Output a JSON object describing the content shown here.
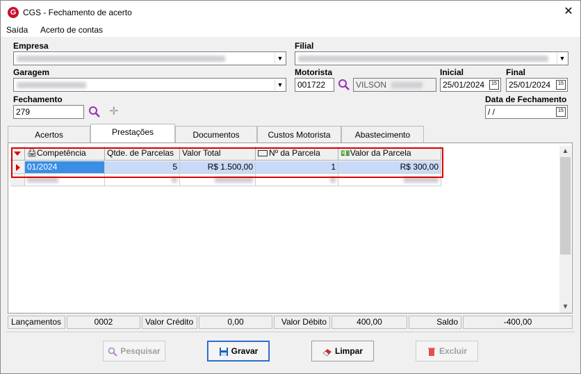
{
  "window": {
    "title": "CGS - Fechamento de acerto",
    "close_glyph": "✕",
    "app_icon_letter": "G"
  },
  "menu": [
    {
      "label": "Saída"
    },
    {
      "label": "Acerto de contas"
    }
  ],
  "form": {
    "empresa_label": "Empresa",
    "filial_label": "Filial",
    "garagem_label": "Garagem",
    "motorista_label": "Motorista",
    "motorista_code": "001722",
    "motorista_name": "VILSON",
    "inicial_label": "Inicial",
    "inicial_value": "25/01/2024",
    "final_label": "Final",
    "final_value": "25/01/2024",
    "fechamento_label": "Fechamento",
    "fechamento_value": "279",
    "data_fechamento_label": "Data de Fechamento",
    "data_fechamento_value": " / /",
    "calendar_glyph": "15"
  },
  "tabs": [
    {
      "label": "Acertos"
    },
    {
      "label": "Prestações"
    },
    {
      "label": "Documentos"
    },
    {
      "label": "Custos Motorista"
    },
    {
      "label": "Abastecimento"
    }
  ],
  "grid": {
    "columns": [
      "Competência",
      "Qtde. de Parcelas",
      "Valor Total",
      "Nº da Parcela",
      "Valor da Parcela"
    ],
    "rows": [
      {
        "competencia": "01/2024",
        "qtde": "5",
        "valor_total": "R$ 1.500,00",
        "num_parcela": "1",
        "valor_parcela": "R$ 300,00"
      }
    ]
  },
  "status": {
    "lancamentos_label": "Lançamentos",
    "lancamentos_value": "0002",
    "credito_label": "Valor Crédito",
    "credito_value": "0,00",
    "debito_label": "Valor Débito",
    "debito_value": "400,00",
    "saldo_label": "Saldo",
    "saldo_value": "-400,00"
  },
  "buttons": {
    "pesquisar": "Pesquisar",
    "gravar": "Gravar",
    "limpar": "Limpar",
    "excluir": "Excluir"
  },
  "colors": {
    "accent": "#3a8ee6",
    "highlight": "#e00000",
    "search": "#9b2fb5"
  }
}
